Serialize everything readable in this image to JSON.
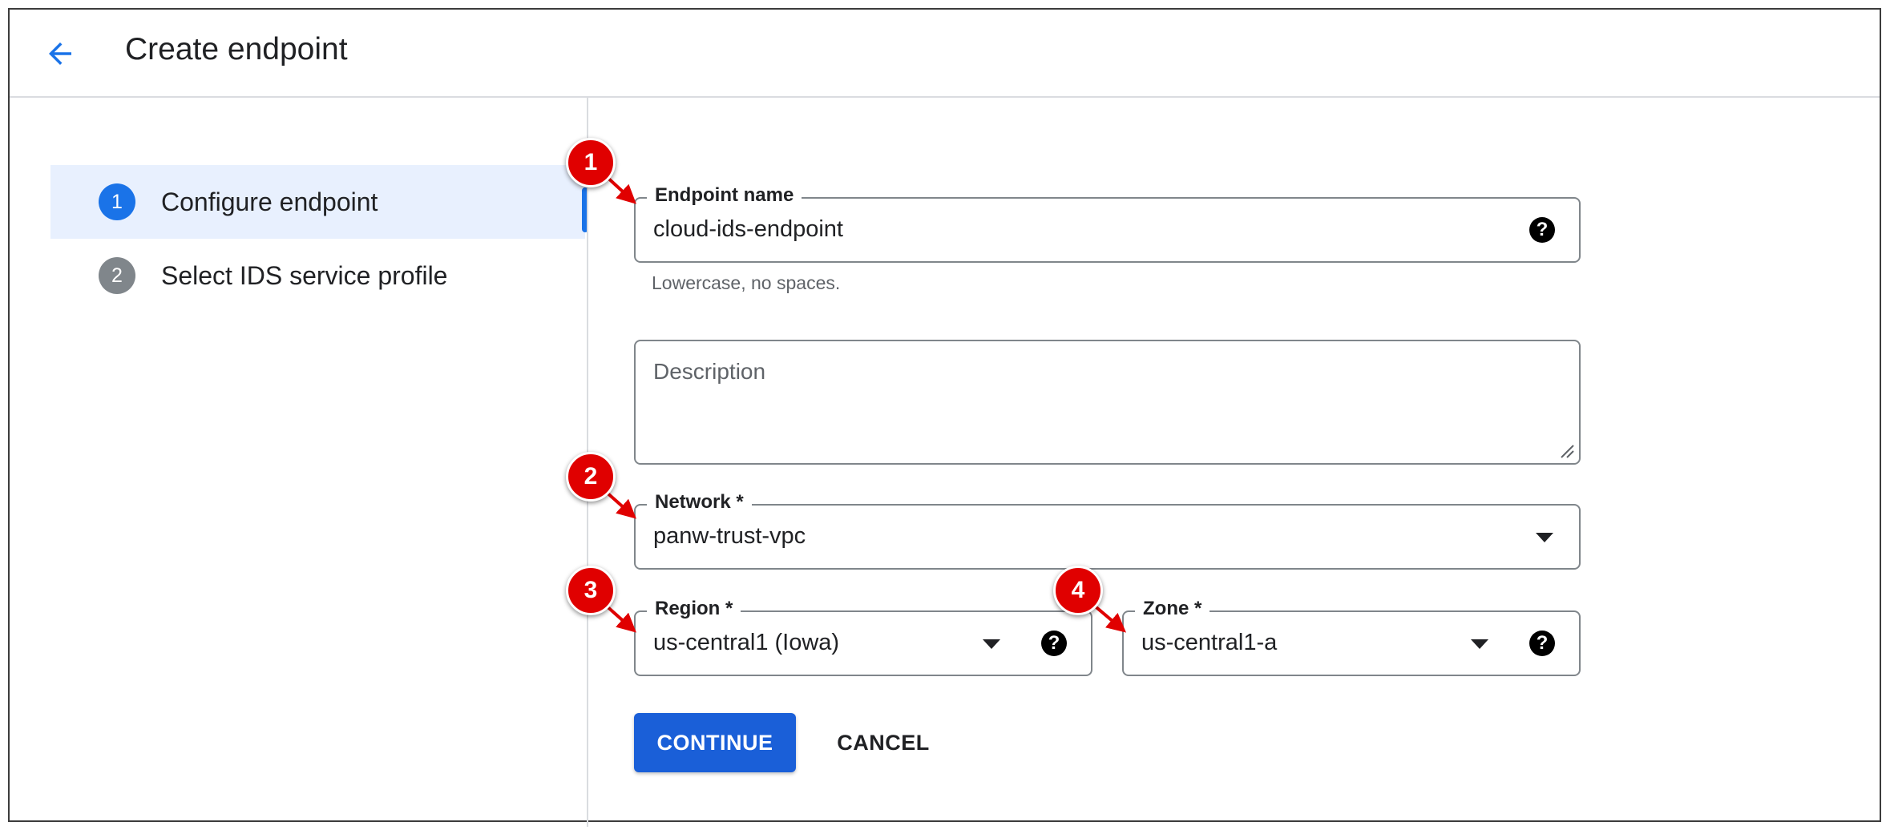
{
  "header": {
    "title": "Create endpoint",
    "back_icon": "arrow-back-icon"
  },
  "steps": [
    {
      "number": "1",
      "label": "Configure endpoint",
      "active": true
    },
    {
      "number": "2",
      "label": "Select IDS service profile",
      "active": false
    }
  ],
  "form": {
    "endpoint_name": {
      "label": "Endpoint name",
      "value": "cloud-ids-endpoint",
      "hint": "Lowercase, no spaces."
    },
    "description": {
      "placeholder": "Description",
      "value": ""
    },
    "network": {
      "label": "Network *",
      "value": "panw-trust-vpc"
    },
    "region": {
      "label": "Region *",
      "value": "us-central1 (Iowa)"
    },
    "zone": {
      "label": "Zone *",
      "value": "us-central1-a"
    },
    "help_glyph": "?"
  },
  "actions": {
    "continue_label": "CONTINUE",
    "cancel_label": "CANCEL"
  },
  "callouts": [
    "1",
    "2",
    "3",
    "4"
  ],
  "colors": {
    "primary": "#1a73e8",
    "button": "#1a5fd8",
    "callout": "#e00000",
    "active_step_bg": "#e8f0fe"
  }
}
